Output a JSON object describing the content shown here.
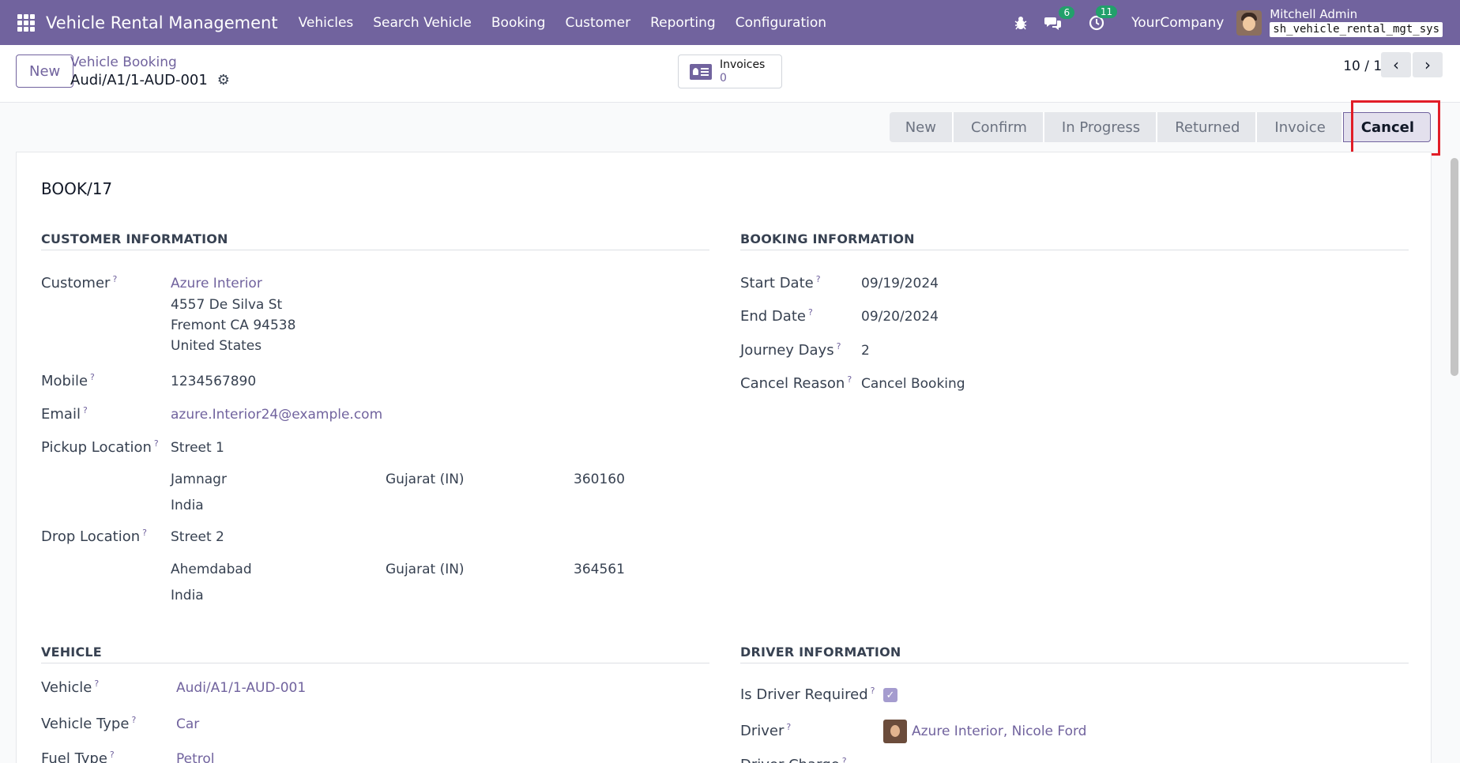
{
  "app": {
    "title": "Vehicle Rental Management",
    "nav": [
      "Vehicles",
      "Search Vehicle",
      "Booking",
      "Customer",
      "Reporting",
      "Configuration"
    ],
    "messages_count": "6",
    "activities_count": "11",
    "company": "YourCompany",
    "user_name": "Mitchell Admin",
    "db_name": "sh_vehicle_rental_mgt_sys"
  },
  "control": {
    "new_label": "New",
    "breadcrumb_parent": "Vehicle Booking",
    "breadcrumb_current": "Audi/A1/1-AUD-001",
    "invoices_label": "Invoices",
    "invoices_count": "0",
    "pager": "10 / 10"
  },
  "statusbar": {
    "stages": [
      "New",
      "Confirm",
      "In Progress",
      "Returned",
      "Invoice",
      "Cancel"
    ],
    "active": "Cancel"
  },
  "record": {
    "name": "BOOK/17",
    "customer_section": "CUSTOMER INFORMATION",
    "booking_section": "BOOKING INFORMATION",
    "vehicle_section": "VEHICLE",
    "driver_section": "DRIVER INFORMATION",
    "labels": {
      "customer": "Customer",
      "mobile": "Mobile",
      "email": "Email",
      "pickup": "Pickup Location",
      "drop": "Drop Location",
      "start_date": "Start Date",
      "end_date": "End Date",
      "journey_days": "Journey Days",
      "cancel_reason": "Cancel Reason",
      "vehicle": "Vehicle",
      "vehicle_type": "Vehicle Type",
      "fuel_type": "Fuel Type",
      "driver_required": "Is Driver Required",
      "driver": "Driver",
      "driver_charge": "Driver Charge"
    },
    "customer": {
      "name": "Azure Interior",
      "street": "4557 De Silva St",
      "city_line": "Fremont CA 94538",
      "country": "United States",
      "mobile": "1234567890",
      "email": "azure.Interior24@example.com"
    },
    "pickup": {
      "street": "Street 1",
      "city": "Jamnagr",
      "state": "Gujarat (IN)",
      "zip": "360160",
      "country": "India"
    },
    "drop": {
      "street": "Street 2",
      "city": "Ahemdabad",
      "state": "Gujarat (IN)",
      "zip": "364561",
      "country": "India"
    },
    "booking": {
      "start_date": "09/19/2024",
      "end_date": "09/20/2024",
      "journey_days": "2",
      "cancel_reason": "Cancel Booking"
    },
    "vehicle": {
      "name": "Audi/A1/1-AUD-001",
      "type": "Car",
      "fuel": "Petrol"
    },
    "driver": {
      "required": true,
      "name": "Azure Interior, Nicole Ford"
    }
  }
}
